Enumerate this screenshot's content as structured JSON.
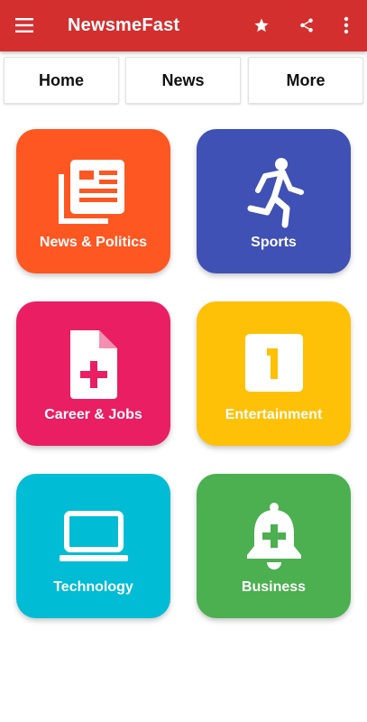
{
  "appbar": {
    "title": "NewsmeFast",
    "color": "#d32f2f",
    "icons": [
      "menu-icon",
      "star-icon",
      "share-icon",
      "more-vert-icon"
    ]
  },
  "tabs": [
    {
      "label": "Home"
    },
    {
      "label": "News"
    },
    {
      "label": "More"
    }
  ],
  "categories": [
    {
      "label": "News & Politics",
      "icon": "newspaper-icon",
      "color": "#fe5722"
    },
    {
      "label": "Sports",
      "icon": "running-person-icon",
      "color": "#3f51b5"
    },
    {
      "label": "Career & Jobs",
      "icon": "document-add-icon",
      "color": "#e91e63"
    },
    {
      "label": "Entertainment",
      "icon": "number-one-box-icon",
      "color": "#ffc107"
    },
    {
      "label": "Technology",
      "icon": "laptop-icon",
      "color": "#00bcd4"
    },
    {
      "label": "Business",
      "icon": "bell-plus-icon",
      "color": "#4caf50"
    }
  ]
}
